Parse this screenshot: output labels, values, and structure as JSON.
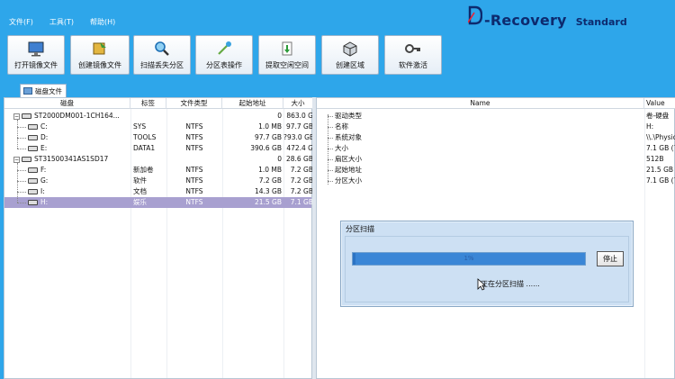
{
  "menu": {
    "file": "文件(F)",
    "tools": "工具(T)",
    "help": "帮助(H)"
  },
  "logo": {
    "text": "-Recovery",
    "edition": "Standard",
    "brand_color": "#0d2a6e"
  },
  "toolbar": [
    {
      "label": "打开镜像文件",
      "icon": "monitor-icon"
    },
    {
      "label": "创建镜像文件",
      "icon": "create-image-icon"
    },
    {
      "label": "扫描丢失分区",
      "icon": "magnifier-icon"
    },
    {
      "label": "分区表操作",
      "icon": "wand-icon"
    },
    {
      "label": "提取空闲空间",
      "icon": "extract-icon"
    },
    {
      "label": "创建区域",
      "icon": "cube-icon"
    },
    {
      "label": "软件激活",
      "icon": "key-icon"
    }
  ],
  "tab": {
    "label": "磁盘文件"
  },
  "disk_table": {
    "headers": [
      "磁盘",
      "标签",
      "文件类型",
      "起始地址",
      "大小"
    ],
    "rows": [
      {
        "disk": "ST2000DM001-1CH164...",
        "label": "",
        "fs": "",
        "start": "0",
        "size": "863.0 G",
        "level": 0
      },
      {
        "disk": "C:",
        "label": "SYS",
        "fs": "NTFS",
        "start": "1.0 MB",
        "size": "97.7 GB",
        "level": 1
      },
      {
        "disk": "D:",
        "label": "TOOLS",
        "fs": "NTFS",
        "start": "97.7 GB",
        "size": "?93.0 GB",
        "level": 1
      },
      {
        "disk": "E:",
        "label": "DATA1",
        "fs": "NTFS",
        "start": "390.6 GB",
        "size": "472.4 G",
        "level": 1
      },
      {
        "disk": "ST31500341AS1SD17",
        "label": "",
        "fs": "",
        "start": "0",
        "size": "28.6 GB",
        "level": 0
      },
      {
        "disk": "F:",
        "label": "新加卷",
        "fs": "NTFS",
        "start": "1.0 MB",
        "size": "7.2 GB",
        "level": 1
      },
      {
        "disk": "G:",
        "label": "软件",
        "fs": "NTFS",
        "start": "7.2 GB",
        "size": "7.2 GB",
        "level": 1
      },
      {
        "disk": "I:",
        "label": "文档",
        "fs": "NTFS",
        "start": "14.3 GB",
        "size": "7.2 GB",
        "level": 1
      },
      {
        "disk": "H:",
        "label": "娱乐",
        "fs": "NTFS",
        "start": "21.5 GB",
        "size": "7.1 GB",
        "level": 1,
        "selected": true
      }
    ]
  },
  "prop_table": {
    "headers": [
      "Name",
      "Value"
    ],
    "rows": [
      {
        "name": "驱动类型",
        "value": "卷-硬盘"
      },
      {
        "name": "名称",
        "value": "H:"
      },
      {
        "name": "系统对象",
        "value": "\\\\.\\Physic"
      },
      {
        "name": "大小",
        "value": "7.1 GB (76"
      },
      {
        "name": "扇区大小",
        "value": "512B"
      },
      {
        "name": "起始地址",
        "value": "21.5 GB (2"
      },
      {
        "name": "分区大小",
        "value": "7.1 GB (76"
      }
    ]
  },
  "dialog": {
    "title": "分区扫描",
    "progress_text": "1%",
    "progress_fraction": 0.01,
    "stop_label": "停止",
    "status": "正在分区扫描 ......"
  },
  "colors": {
    "background": "#2ea6ea",
    "selected_row": "#a8a0d0",
    "progress": "#3a86d6"
  }
}
